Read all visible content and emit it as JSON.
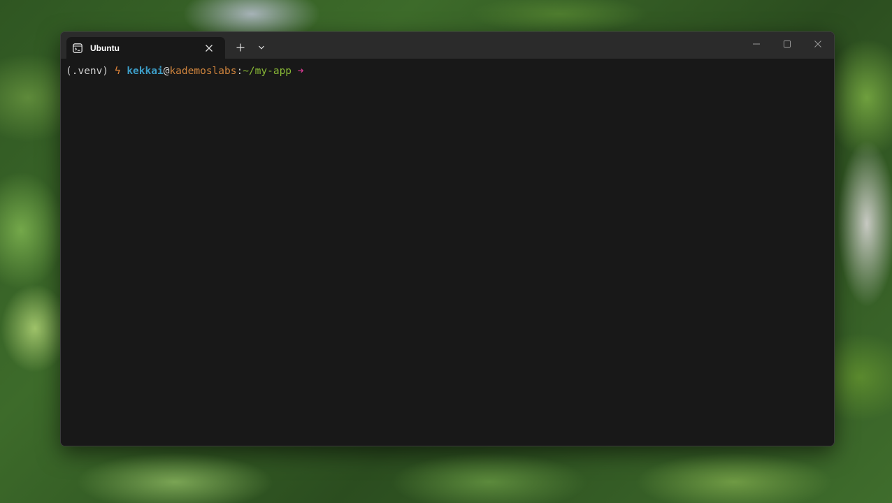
{
  "window": {
    "tab": {
      "title": "Ubuntu",
      "icon": "terminal-icon"
    },
    "tabbar_icons": {
      "close_tab": "close-icon",
      "new_tab": "plus-icon",
      "dropdown": "chevron-down-icon"
    },
    "caption_icons": {
      "minimize": "minimize-icon",
      "maximize": "maximize-icon",
      "close": "close-icon"
    }
  },
  "terminal": {
    "prompt": {
      "venv": "(.venv)",
      "bolt": "ϟ",
      "user": "kekkai",
      "at": "@",
      "host": "kademoslabs",
      "colon": ":",
      "path": "~/my-app",
      "arrow": "➜"
    },
    "colors": {
      "background": "#181818",
      "user": "#3c9cc6",
      "host": "#d1853d",
      "path": "#88b836",
      "arrow": "#d0388d",
      "bolt": "#e5873a"
    }
  }
}
